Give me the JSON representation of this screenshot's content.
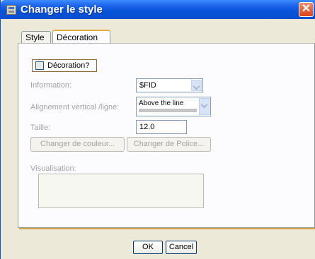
{
  "window": {
    "title": "Changer le style",
    "close_symbol": "✕"
  },
  "tabs": [
    {
      "label": "Style",
      "selected": false
    },
    {
      "label": "Décoration",
      "selected": true
    }
  ],
  "decoration": {
    "checkbox_label": "Décoration?",
    "checkbox_checked": false,
    "information_label": "Information:",
    "information_value": "$FID",
    "alignment_label": "Alignement vertical /ligne:",
    "alignment_value": "Above the line",
    "size_label": "Taille:",
    "size_value": "12.0",
    "color_button": "Changer de couleur...",
    "font_button": "Changer de Police...",
    "preview_label": "Visualisation:"
  },
  "buttons": {
    "ok": "OK",
    "cancel": "Cancel"
  },
  "colors": {
    "titlebar": "#0a4fcf",
    "selected_tab_accent": "#e9a93a",
    "disabled_text": "#a3a3a3"
  }
}
